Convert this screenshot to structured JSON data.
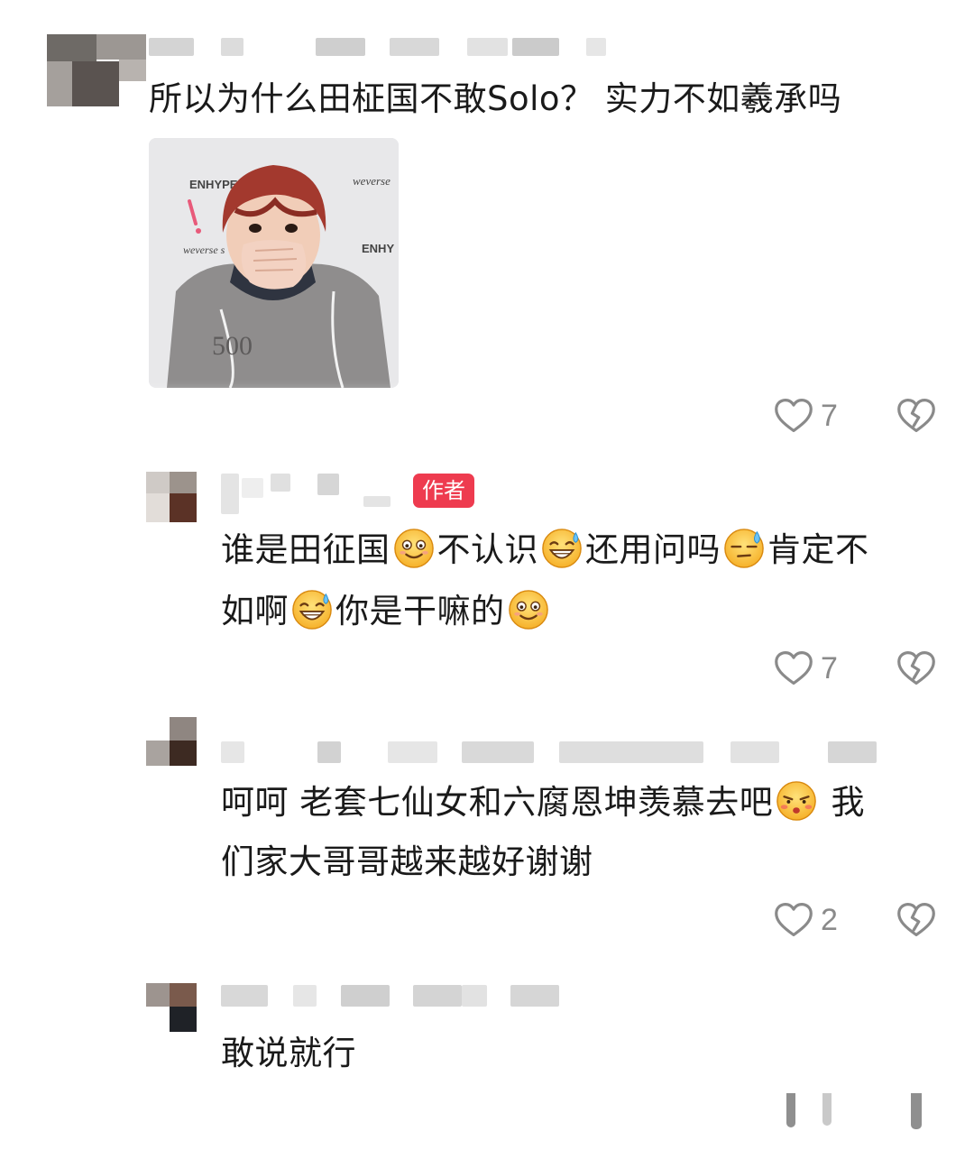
{
  "comments": [
    {
      "text": "所以为什么田柾国不敢Solo？ 实力不如羲承吗",
      "image_caption_texts": [
        "ENHYPEN",
        "weverse",
        "weverse s",
        "ENHY",
        "500"
      ],
      "likes": "7"
    },
    {
      "author_badge": "作者",
      "line1_parts": [
        "谁是田征国",
        "不认识",
        "还用问吗",
        "肯定不"
      ],
      "line2_parts": [
        "如啊",
        "你是干嘛的"
      ],
      "likes": "7"
    },
    {
      "line1_parts": [
        "呵呵 老套七仙女和六腐恩坤羡慕去吧",
        " 我"
      ],
      "line2": "们家大哥哥越来越好谢谢",
      "likes": "2"
    },
    {
      "text": "敢说就行"
    }
  ],
  "icons": {
    "like": "heart-outline-icon",
    "dislike": "broken-heart-icon",
    "emoji_smile": "smile-emoji-icon",
    "emoji_sweat_grin": "sweat-grin-emoji-icon",
    "emoji_sweat_meh": "downcast-sweat-emoji-icon",
    "emoji_pout": "pouting-emoji-icon"
  },
  "colors": {
    "badge": "#ee3b4f",
    "icon_gray": "#8a8a8a",
    "text": "#1a1a1a"
  }
}
